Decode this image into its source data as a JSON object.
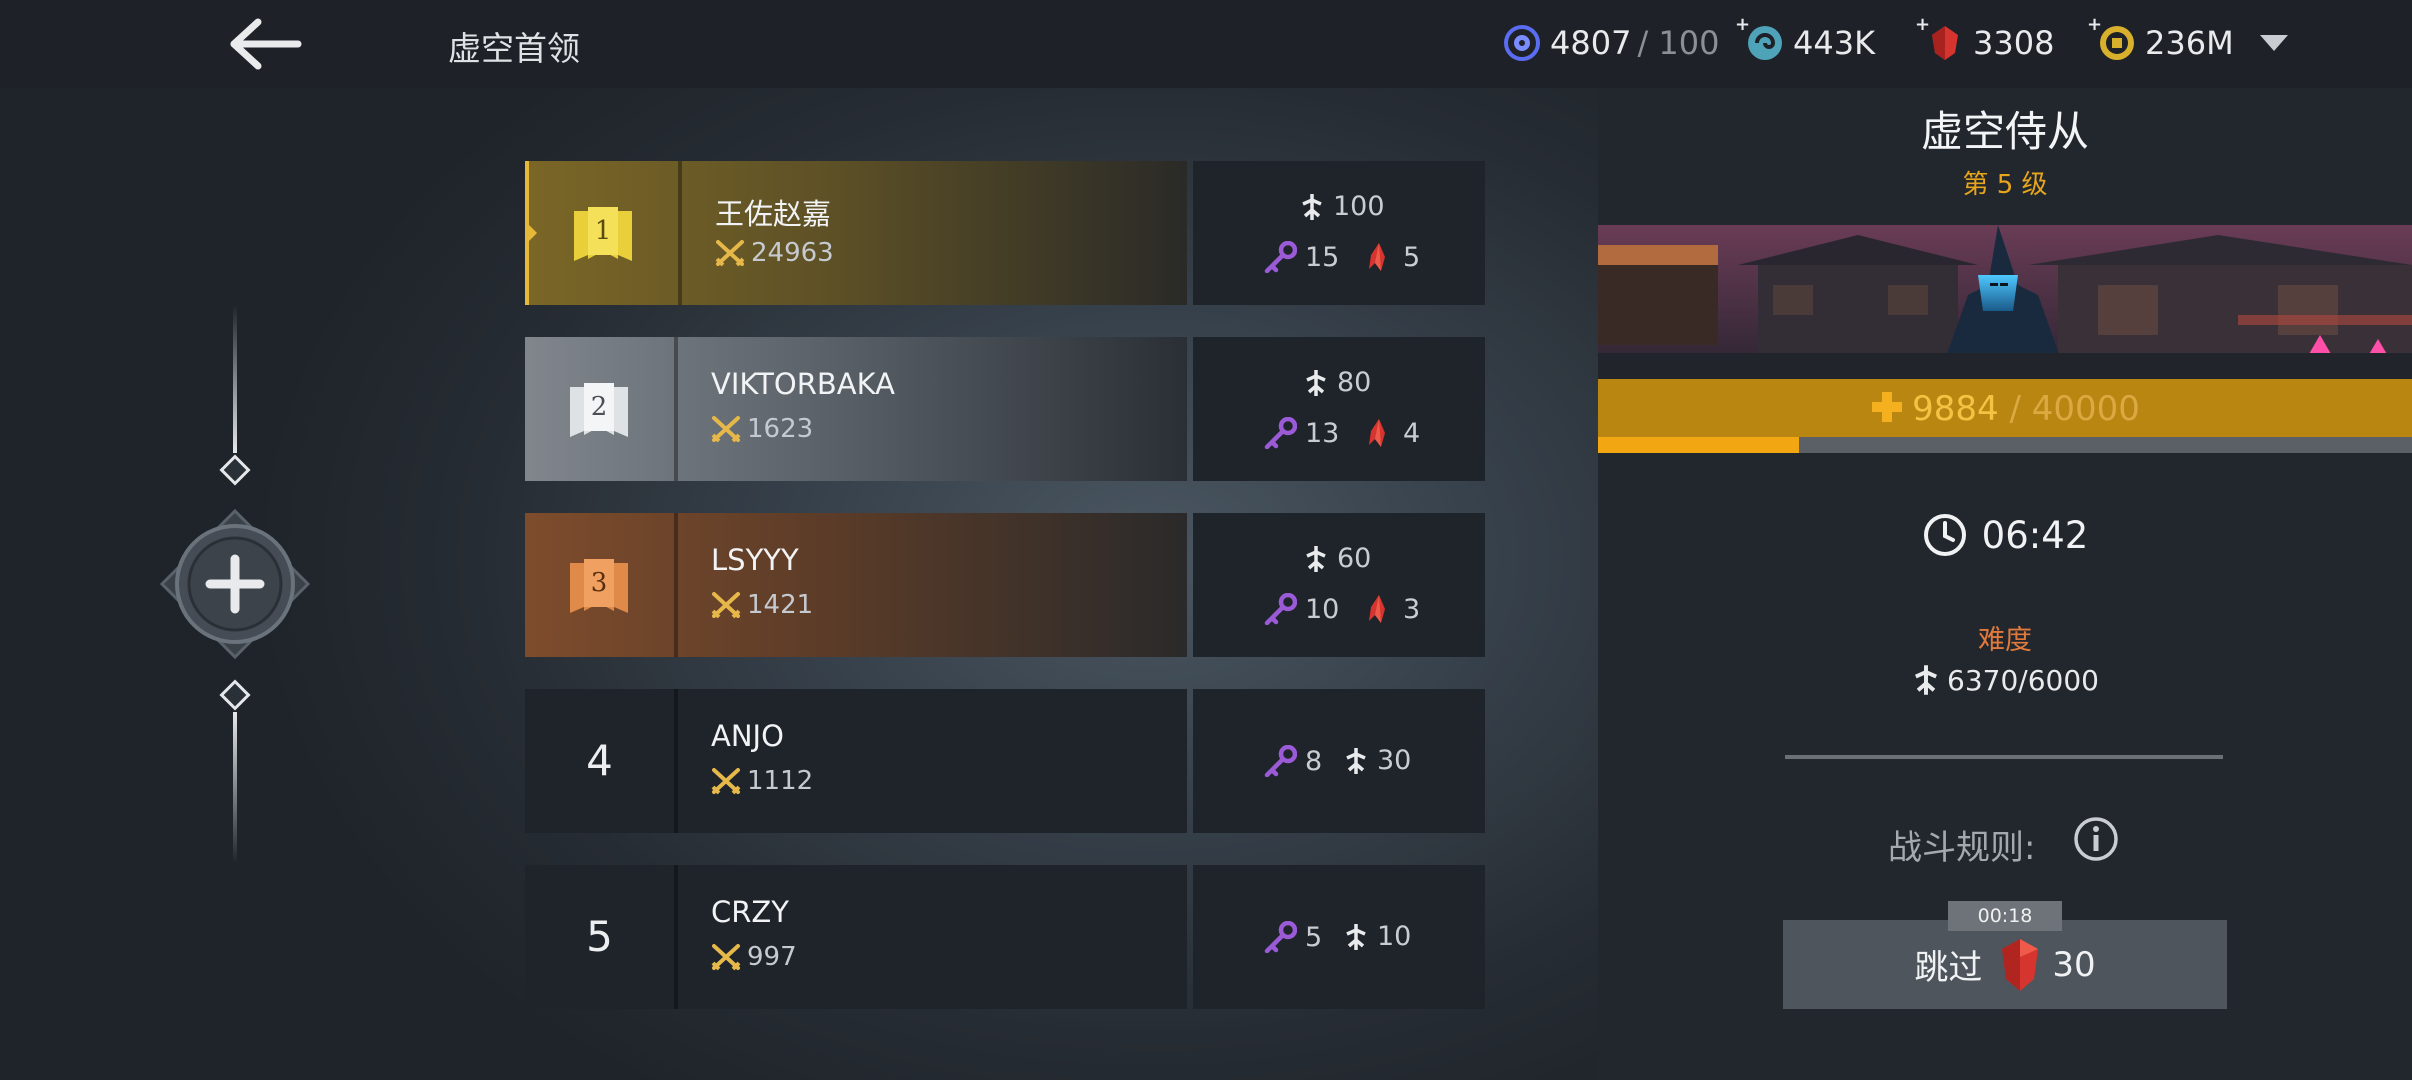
{
  "header": {
    "title": "虚空首领",
    "resources": [
      {
        "icon": "void-orb-icon",
        "value": "4807",
        "max": "/ 100",
        "has_plus": false
      },
      {
        "icon": "swirl-currency-icon",
        "value": "443K",
        "has_plus": true
      },
      {
        "icon": "red-gem-icon",
        "value": "3308",
        "has_plus": true
      },
      {
        "icon": "gold-coin-icon",
        "value": "236M",
        "has_plus": true
      }
    ]
  },
  "leaderboard": [
    {
      "rank": "1",
      "name": "王佐赵嘉",
      "score": "24963",
      "power": "100",
      "keys": "15",
      "gems": "5",
      "tier": "gold"
    },
    {
      "rank": "2",
      "name": "VIKTORBAKA",
      "score": "1623",
      "power": "80",
      "keys": "13",
      "gems": "4",
      "tier": "silver"
    },
    {
      "rank": "3",
      "name": "LSYYY",
      "score": "1421",
      "power": "60",
      "keys": "10",
      "gems": "3",
      "tier": "bronze"
    },
    {
      "rank": "4",
      "name": "ANJO",
      "score": "1112",
      "keys": "8",
      "power": "30"
    },
    {
      "rank": "5",
      "name": "CRZY",
      "score": "997",
      "keys": "5",
      "power": "10"
    }
  ],
  "boss": {
    "name": "虚空侍从",
    "level": "第 5 级",
    "hp_current": "9884",
    "hp_max": "/ 40000",
    "hp_fraction": 0.247,
    "timer": "06:42",
    "difficulty_label": "难度",
    "difficulty_value": "6370/6000",
    "rules_label": "战斗规则:",
    "skip_timer": "00:18",
    "skip_label": "跳过",
    "skip_cost": "30"
  },
  "colors": {
    "gold": "#f2a712",
    "gold_row": "#6b5a26",
    "silver_row": "#7a8086",
    "bronze_row": "#7a4a2a",
    "key": "#9b5ad6",
    "gem": "#d6342e",
    "difficulty": "#e07a3c"
  }
}
